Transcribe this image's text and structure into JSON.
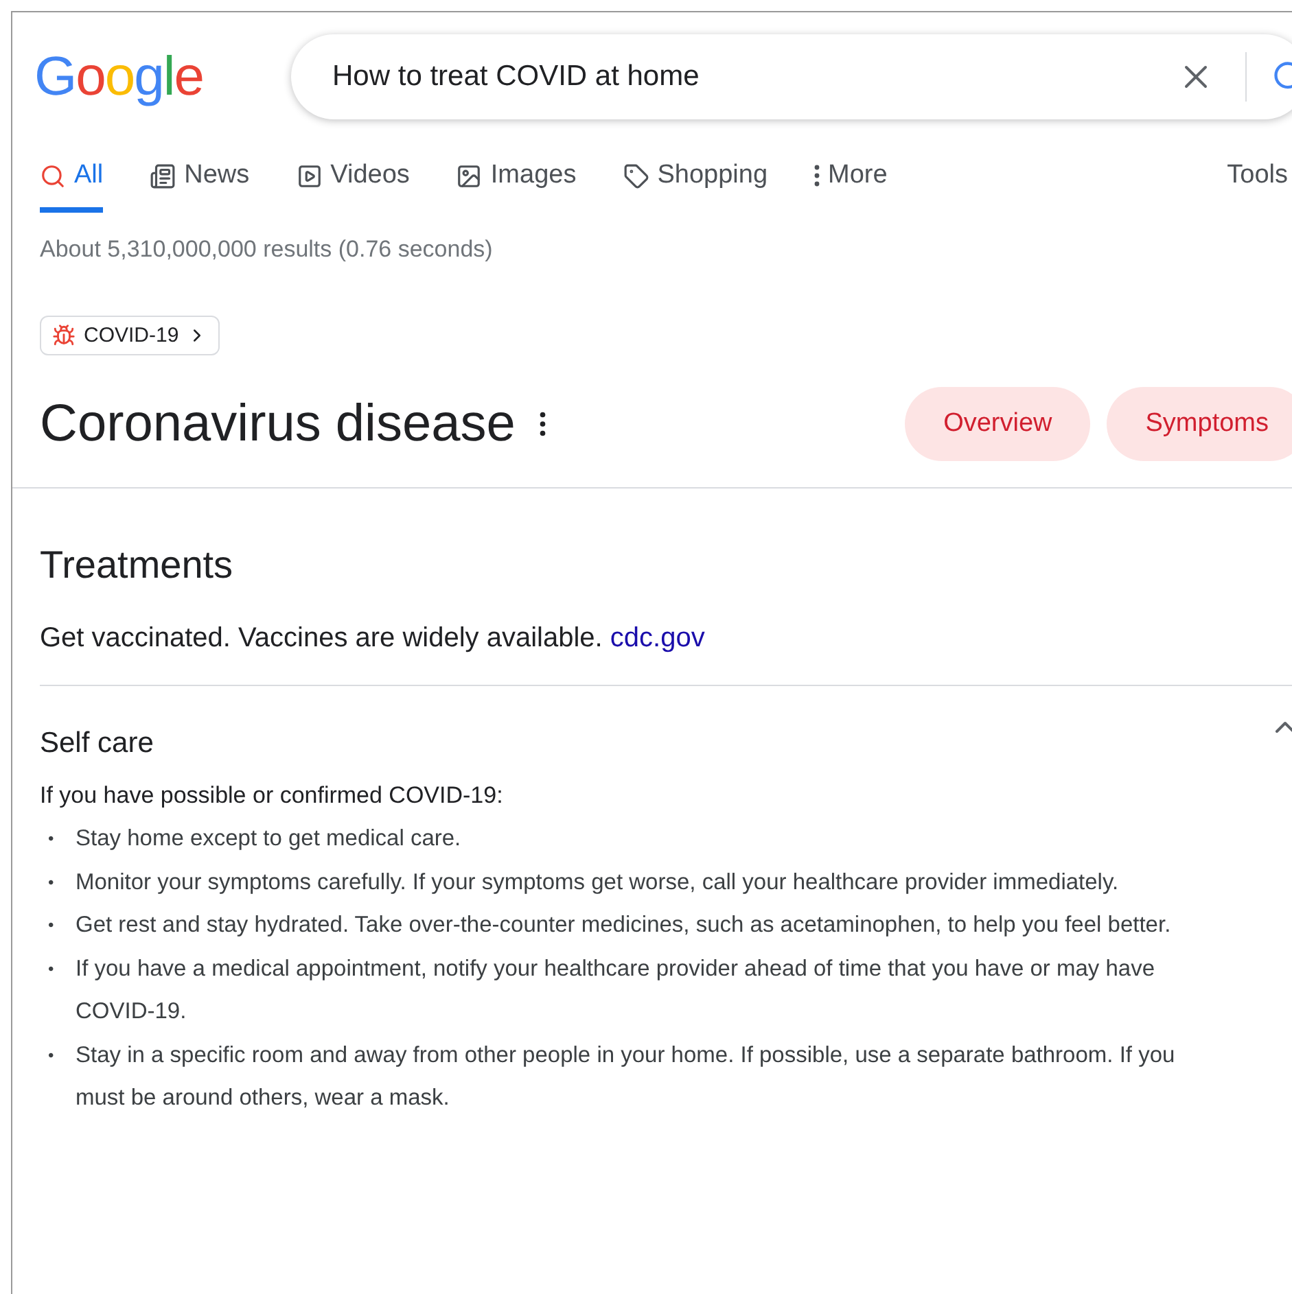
{
  "logo": {
    "letters": [
      {
        "char": "G",
        "color": "#4285f4"
      },
      {
        "char": "o",
        "color": "#ea4335"
      },
      {
        "char": "o",
        "color": "#fbbc05"
      },
      {
        "char": "g",
        "color": "#4285f4"
      },
      {
        "char": "l",
        "color": "#34a853"
      },
      {
        "char": "e",
        "color": "#ea4335"
      }
    ]
  },
  "search": {
    "value": "How to treat COVID at home"
  },
  "tabs": [
    {
      "label": "All",
      "selected": true
    },
    {
      "label": "News",
      "selected": false
    },
    {
      "label": "Videos",
      "selected": false
    },
    {
      "label": "Images",
      "selected": false
    },
    {
      "label": "Shopping",
      "selected": false
    },
    {
      "label": "More",
      "selected": false
    }
  ],
  "tools": "Tools",
  "result_stats": "About 5,310,000,000 results (0.76 seconds)",
  "topic_chip": "COVID-19",
  "title": "Coronavirus disease",
  "section_chips": [
    {
      "label": "Overview"
    },
    {
      "label": "Symptoms"
    }
  ],
  "treatments": {
    "heading": "Treatments",
    "text": "Get vaccinated. Vaccines are widely available.",
    "source": "cdc.gov"
  },
  "self_care": {
    "heading": "Self care",
    "expanded": true,
    "intro": "If you have possible or confirmed COVID-19:",
    "items": [
      {
        "bullet": "•",
        "text": "Stay home except to get medical care."
      },
      {
        "bullet": "•",
        "text": "Monitor your symptoms carefully. If your symptoms get worse, call your healthcare provider immediately."
      },
      {
        "bullet": "•",
        "text": "Get rest and stay hydrated. Take over-the-counter medicines, such as acetaminophen, to help you feel better."
      },
      {
        "bullet": "•",
        "text": "If you have a medical appointment, notify your healthcare provider ahead of time that you have or may have COVID-19."
      },
      {
        "bullet": "•",
        "text": "Stay in a specific room and away from other people in your home. If possible, use a separate bathroom. If you must be around others, wear a mask."
      }
    ]
  }
}
